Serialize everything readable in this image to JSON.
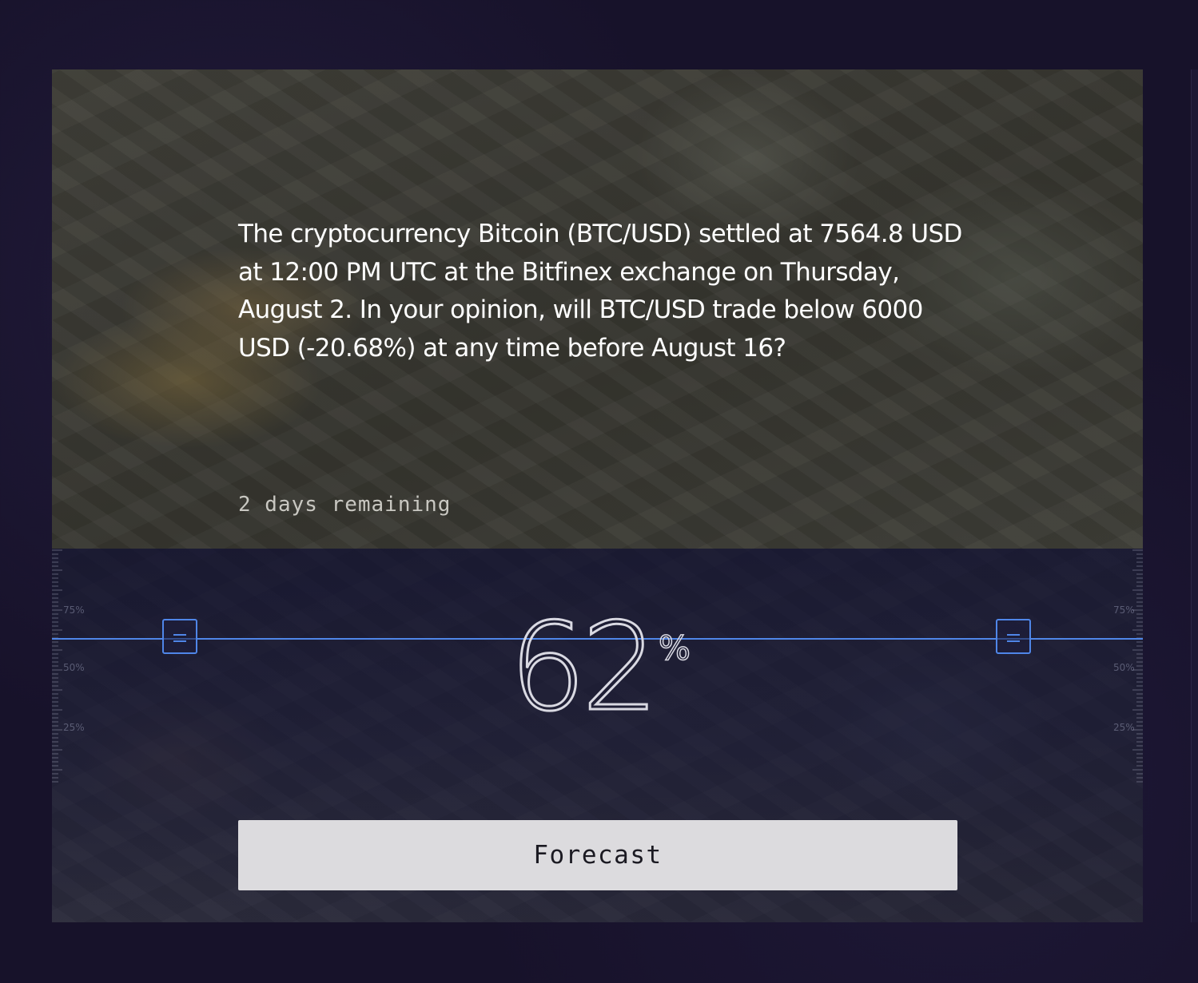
{
  "question": {
    "text": "The cryptocurrency Bitcoin (BTC/USD) settled at 7564.8 USD at 12:00 PM UTC at the Bitfinex exchange on Thursday, August 2. In your opinion, will BTC/USD trade below 6000 USD (-20.68%) at any time before August 16?",
    "time_remaining": "2 days remaining"
  },
  "forecast": {
    "value": "62",
    "value_fraction": 0.62,
    "unit": "%",
    "scale_labels": {
      "high": "75%",
      "mid": "50%",
      "low": "25%"
    },
    "submit_label": "Forecast"
  },
  "colors": {
    "accent": "#4f86e8",
    "page_background": "#17122a",
    "button_background": "#dcdbde",
    "text_primary": "#ffffff"
  },
  "icons": {
    "handle": "drag-handle-icon"
  }
}
